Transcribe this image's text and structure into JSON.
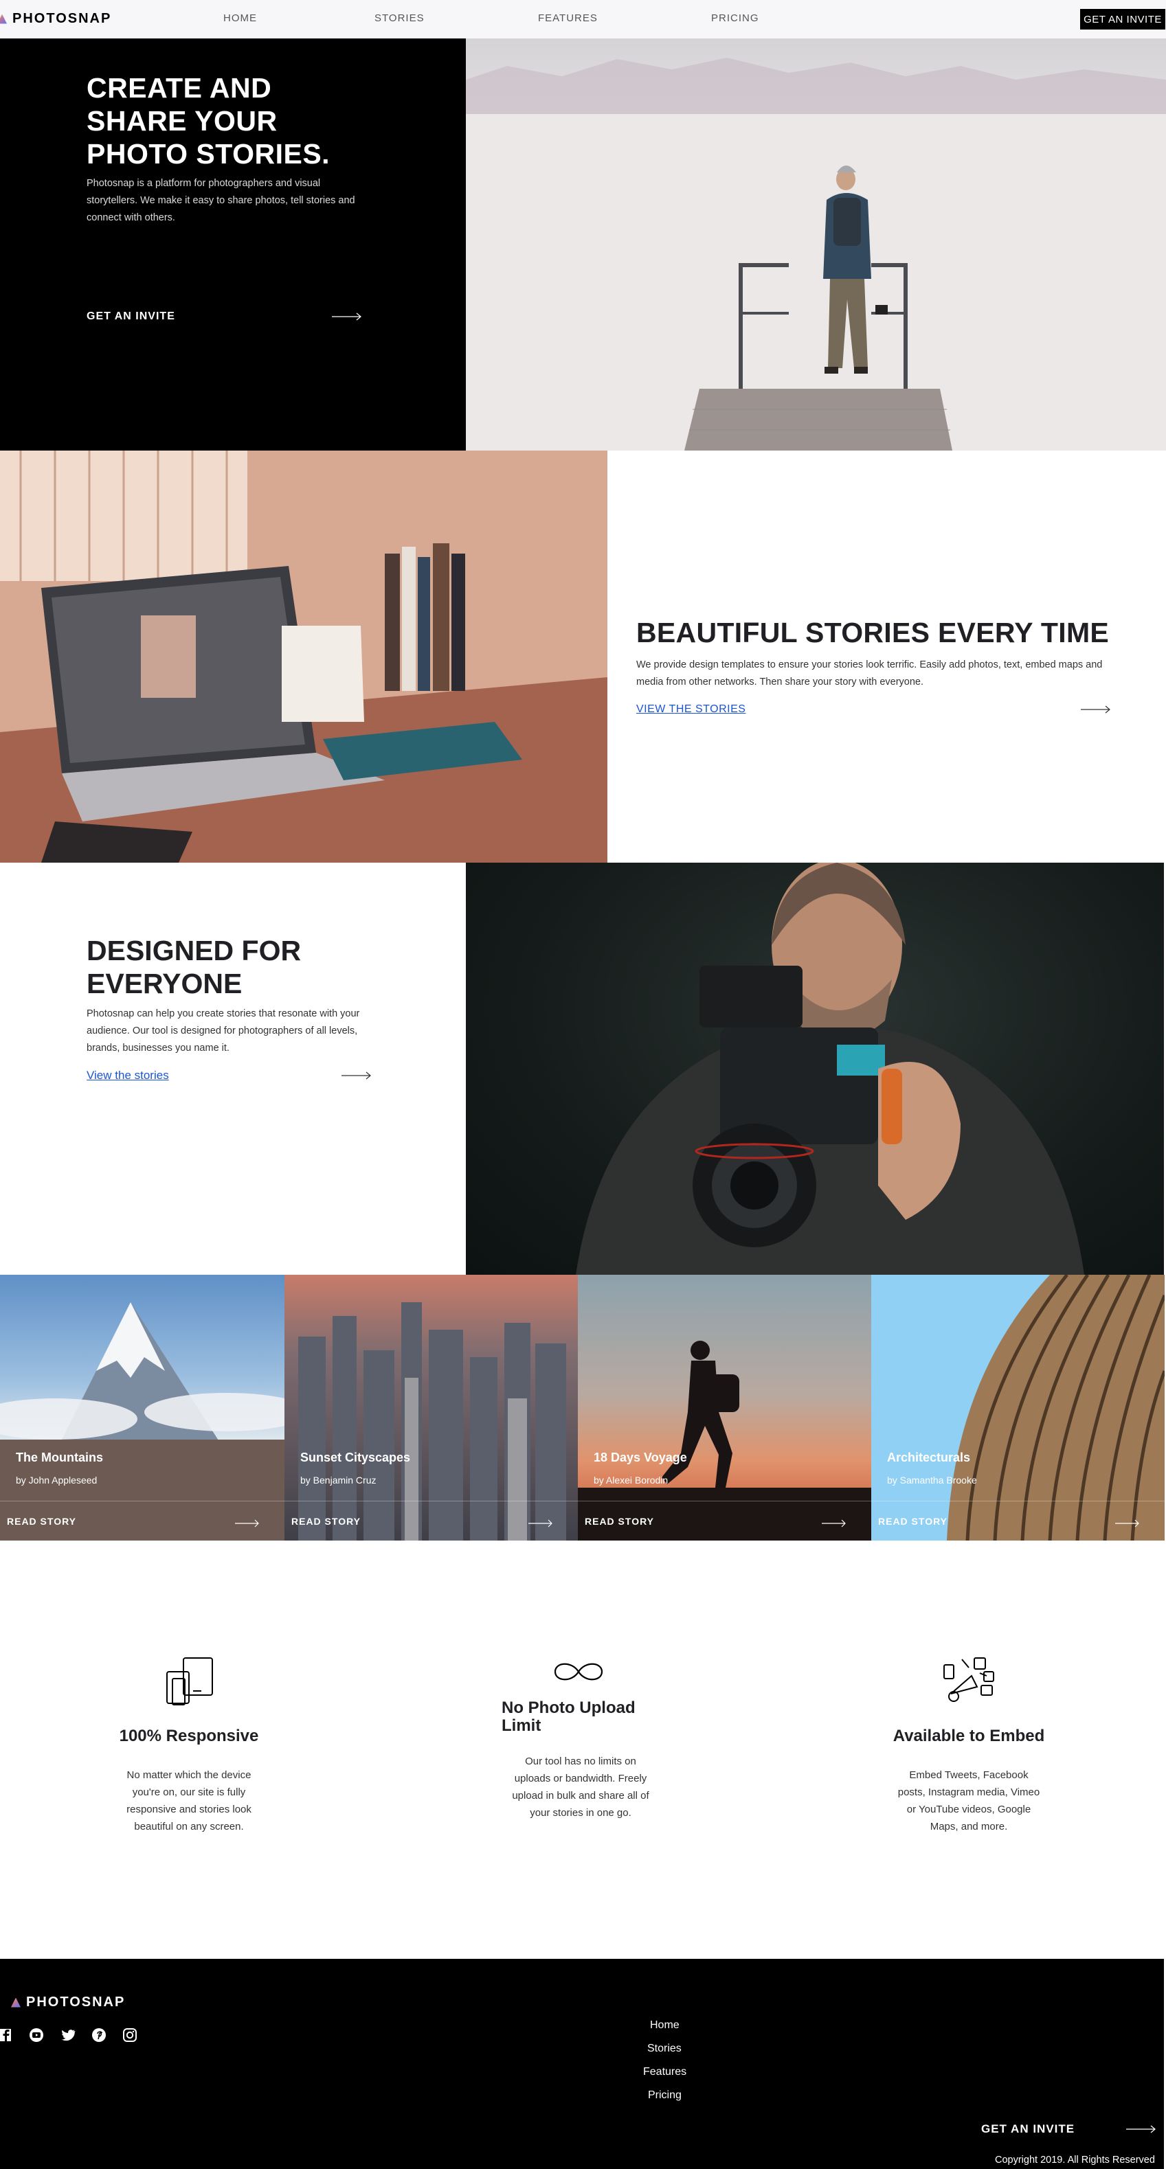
{
  "nav": {
    "logo": "PHOTOSNAP",
    "links": [
      "HOME",
      "STORIES",
      "FEATURES",
      "PRICING"
    ],
    "cta": "GET AN INVITE"
  },
  "hero": {
    "title": "CREATE AND SHARE YOUR PHOTO STORIES.",
    "text": "Photosnap is a platform for photographers and visual storytellers. We make it easy to share photos, tell stories and connect with others.",
    "cta": "GET AN INVITE"
  },
  "beautiful": {
    "title": "BEAUTIFUL STORIES EVERY TIME",
    "text": "We provide design templates to ensure your stories look terrific. Easily add photos, text, embed maps and media from other networks. Then share your story with everyone.",
    "link": "VIEW THE STORIES"
  },
  "designed": {
    "title": "DESIGNED FOR EVERYONE",
    "text": "Photosnap can help you create stories that resonate with your audience. Our tool is designed for photographers of all levels, brands, businesses you name it.",
    "link": "View the stories"
  },
  "stories": [
    {
      "title": "The Mountains",
      "author": "by John Appleseed",
      "read": "READ STORY"
    },
    {
      "title": "Sunset Cityscapes",
      "author": "by Benjamin Cruz",
      "read": "READ STORY"
    },
    {
      "title": "18 Days Voyage",
      "author": "by Alexei Borodin",
      "read": "READ STORY"
    },
    {
      "title": "Architecturals",
      "author": "by Samantha Brooke",
      "read": "READ STORY"
    }
  ],
  "features": [
    {
      "icon": "responsive-devices-icon",
      "title": "100% Responsive",
      "text": "No matter which the device you're on, our site is fully responsive and stories look beautiful on any screen."
    },
    {
      "icon": "infinity-icon",
      "title": "No Photo Upload Limit",
      "text": "Our tool has no limits on uploads or bandwidth. Freely upload in bulk and share all of your stories in one go."
    },
    {
      "icon": "embed-megaphone-icon",
      "title": "Available to Embed",
      "text": "Embed Tweets, Facebook posts, Instagram media, Vimeo or YouTube videos, Google Maps, and more."
    }
  ],
  "footer": {
    "logo": "PHOTOSNAP",
    "social": [
      "facebook-icon",
      "youtube-icon",
      "twitter-icon",
      "pinterest-icon",
      "instagram-icon"
    ],
    "links": [
      "Home",
      "Stories",
      "Features",
      "Pricing"
    ],
    "cta": "GET AN INVITE",
    "copyright": "Copyright 2019. All Rights Reserved"
  }
}
